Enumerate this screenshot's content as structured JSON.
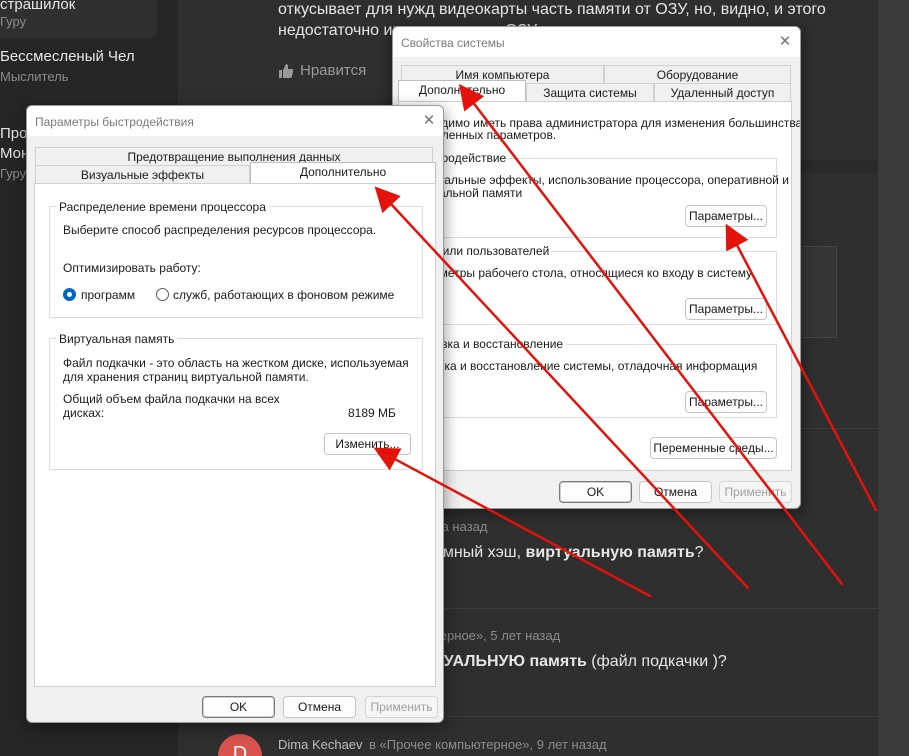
{
  "background": {
    "sidebar": {
      "user1_name": "страшилок",
      "user1_role": "Гуру",
      "user2_name": "Бессмесленый Чел",
      "user2_role": "Мыслитель",
      "user3_name_a": "Про",
      "user3_name_b": "Мон",
      "user3_role": "Гуру"
    },
    "answer_text_line1": "откусывает для нужд видеокарты часть памяти от ОЗУ, но, видно, и этого",
    "answer_text_line2": "недостаточно иг",
    "answer_text_line2_tail": "ОЗУ",
    "like_label": "Нравится",
    "q1_meta": "да назад",
    "q1_text_pre": "емный хэш, ",
    "q1_text_bold": "виртуальную память",
    "q1_text_post": "?",
    "q2_meta": "терное», 5 лет назад",
    "q2_text_bold": "ТУАЛЬНУЮ память",
    "q2_text_post": " (файл подкачки )?",
    "q3_author": "Dima Kechaev",
    "q3_meta": "в «Прочее компьютерное», 9 лет назад",
    "q3_avatar_letter": "D"
  },
  "system_props": {
    "title": "Свойства системы",
    "tabs_row1": [
      "Имя компьютера",
      "Оборудование"
    ],
    "tabs_row2": [
      "Дополнительно",
      "Защита системы",
      "Удаленный доступ"
    ],
    "admin_note_l1": "ходимо иметь права администратора для изменения большинства",
    "admin_note_l2": "исленных параметров.",
    "perf_title": "тродействие",
    "perf_desc_l1": "зуальные эффекты, использование процессора, оперативной и",
    "perf_desc_l2": "уальной памяти",
    "perf_button": "Параметры...",
    "profiles_title": "рили пользователей",
    "profiles_desc": "аметры рабочего стола, относящиеся ко входу в систему",
    "profiles_button": "Параметры...",
    "startup_title": "узка и восстановление",
    "startup_desc": "узка и восстановление системы, отладочная информация",
    "startup_button": "Параметры...",
    "env_button": "Переменные среды...",
    "ok": "OK",
    "cancel": "Отмена",
    "apply": "Применить"
  },
  "perf_options": {
    "title": "Параметры быстродействия",
    "tab_top": "Предотвращение выполнения данных",
    "tab_visual": "Визуальные эффекты",
    "tab_advanced": "Дополнительно",
    "cpu_group_title": "Распределение времени процессора",
    "cpu_desc": "Выберите способ распределения ресурсов процессора.",
    "optimize_label": "Оптимизировать работу:",
    "radio_programs": "программ",
    "radio_services": "служб, работающих в фоновом режиме",
    "vm_group_title": "Виртуальная память",
    "vm_desc_l1": "Файл подкачки - это область на жестком диске, используемая",
    "vm_desc_l2": "для хранения страниц виртуальной памяти.",
    "vm_total_l1": "Общий объем файла подкачки на всех",
    "vm_total_l2": "дисках:",
    "vm_total_value": "8189 МБ",
    "change_button": "Изменить...",
    "ok": "OK",
    "cancel": "Отмена",
    "apply": "Применить"
  },
  "colors": {
    "arrow": "#e3120b"
  }
}
